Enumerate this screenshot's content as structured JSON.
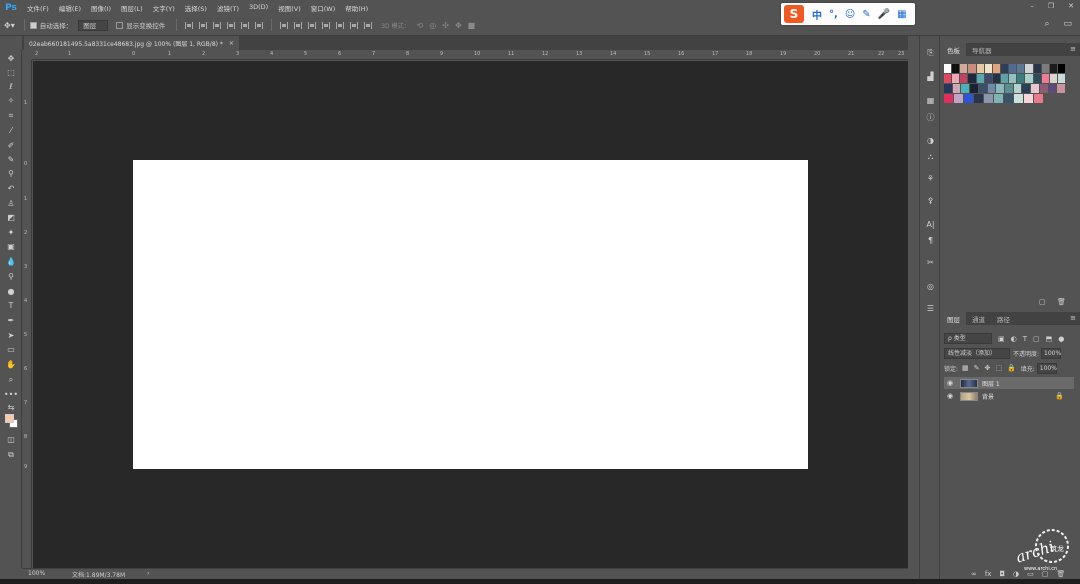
{
  "app": {
    "logo": "Ps"
  },
  "menu": {
    "items": [
      "文件(F)",
      "编辑(E)",
      "图像(I)",
      "图层(L)",
      "文字(Y)",
      "选择(S)",
      "滤镜(T)",
      "3D(D)",
      "视图(V)",
      "窗口(W)",
      "帮助(H)"
    ]
  },
  "window_controls": {
    "minimize": "–",
    "restore": "❐",
    "close": "✕"
  },
  "options": {
    "auto_select_label": "自动选择：",
    "auto_select_value": "图层",
    "show_transform_label": "显示变换控件",
    "mode_3d_label": "3D 模式："
  },
  "ime": {
    "logo": "S",
    "items": [
      "中",
      "°,",
      "☺",
      "✎",
      "🎤",
      "▦"
    ]
  },
  "document": {
    "tab_title": "02eab660181495.5a8331ce48683.jpg @ 100% (图层 1, RGB/8) *",
    "canvas_color": "#ffffff"
  },
  "rulers": {
    "top_labels": [
      "2",
      "1",
      "0",
      "1",
      "2",
      "3",
      "4",
      "5",
      "6",
      "7",
      "8",
      "9",
      "10",
      "11",
      "12",
      "13",
      "14",
      "15",
      "16",
      "17",
      "18",
      "19",
      "20",
      "21",
      "22",
      "23"
    ],
    "left_labels": [
      "1",
      "0",
      "1",
      "2",
      "3",
      "4",
      "5",
      "6",
      "7",
      "8",
      "9"
    ]
  },
  "status": {
    "zoom": "100%",
    "doc_info": "文档:1.89M/3.78M",
    "arrow": "›"
  },
  "swatches_panel": {
    "tabs": [
      "色板",
      "导航器"
    ],
    "rows": [
      [
        "#ffffff",
        "#101010",
        "#d4a89a",
        "#c98d80",
        "#e6c8a0",
        "#f0e2c8",
        "#e2a27a",
        "#2d3e58",
        "#4f6d93",
        "#5d7894",
        "#cfd4d8",
        "#2b3547",
        "#7c7c7c",
        "#1d1d1d",
        "#000000"
      ],
      [
        "#e4485e",
        "#f0a6b2",
        "#c24262",
        "#202a3c",
        "#56a9b0",
        "#3c4b6a",
        "#24324a",
        "#5fa1a4",
        "#8ec3c1",
        "#3b7b82",
        "#a8cfc8",
        "#2f4a58",
        "#ef7c94",
        "#d9d5cc",
        "#c7dbdc"
      ],
      [
        "#26355a",
        "#d2a5b6",
        "#48b4b6",
        "#1a2336",
        "#3a4e6e",
        "#6f8aa6",
        "#89b9ba",
        "#5b8e94",
        "#b2d4cf",
        "#2a3e56",
        "#e9c7cf",
        "#8d5b74",
        "#5d4c7a",
        "#c4939f"
      ],
      [
        "#e0305a",
        "#c1a3c7",
        "#2e54d8",
        "#2a3549",
        "#8b97a8",
        "#7fb3b6",
        "#3b5368",
        "#cde0dc",
        "#f5d6da",
        "#e87b8a"
      ]
    ]
  },
  "layers_panel": {
    "tabs": [
      "图层",
      "通道",
      "路径"
    ],
    "filter_label": "ρ 类型",
    "blend_mode": "线性减淡（添加）",
    "opacity_label": "不透明度:",
    "opacity_value": "100%",
    "lock_label": "锁定:",
    "fill_label": "填充:",
    "fill_value": "100%",
    "layers": [
      {
        "name": "图层 1",
        "selected": true,
        "locked": false
      },
      {
        "name": "背景",
        "selected": false,
        "locked": true
      }
    ],
    "footer_fx": "fx"
  },
  "watermark": {
    "brand": "archi",
    "sub": "www.archi.cn",
    "text": "筑龙"
  }
}
